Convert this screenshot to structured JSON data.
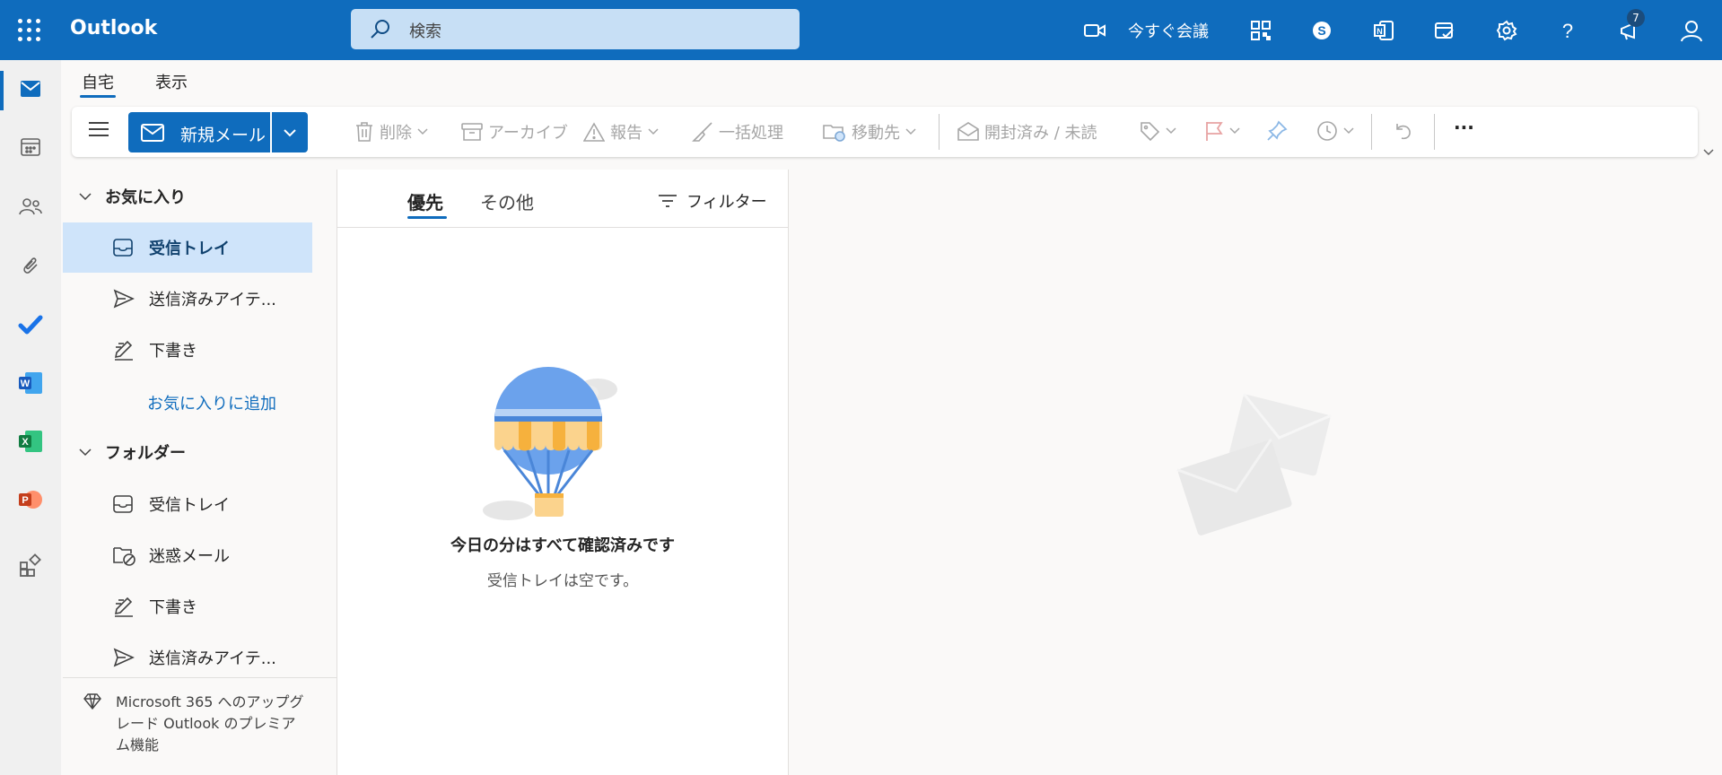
{
  "app": {
    "name": "Outlook"
  },
  "search": {
    "placeholder": "検索"
  },
  "header": {
    "meet_now": "今すぐ会議",
    "notification_count": "7"
  },
  "tabs": [
    {
      "label": "自宅"
    },
    {
      "label": "表示"
    }
  ],
  "toolbar": {
    "new_mail": "新規メール",
    "delete": "削除",
    "archive": "アーカイブ",
    "report": "報告",
    "sweep": "一括処理",
    "move_to": "移動先",
    "read_unread": "開封済み / 未読",
    "more": "···"
  },
  "folders": {
    "favorites_header": "お気に入り",
    "favorites": [
      {
        "label": "受信トレイ"
      },
      {
        "label": "送信済みアイテ..."
      },
      {
        "label": "下書き"
      }
    ],
    "add_favorite": "お気に入りに追加",
    "folders_header": "フォルダー",
    "items": [
      {
        "label": "受信トレイ"
      },
      {
        "label": "迷惑メール"
      },
      {
        "label": "下書き"
      },
      {
        "label": "送信済みアイテ..."
      }
    ],
    "upgrade": "Microsoft 365 へのアップグレード Outlook のプレミアム機能"
  },
  "message_list": {
    "tab_focused": "優先",
    "tab_other": "その他",
    "filter": "フィルター",
    "empty_title": "今日の分はすべて確認済みです",
    "empty_subtitle": "受信トレイは空です。"
  },
  "colors": {
    "accent": "#0f6cbd",
    "selected": "#cfe4fa"
  }
}
